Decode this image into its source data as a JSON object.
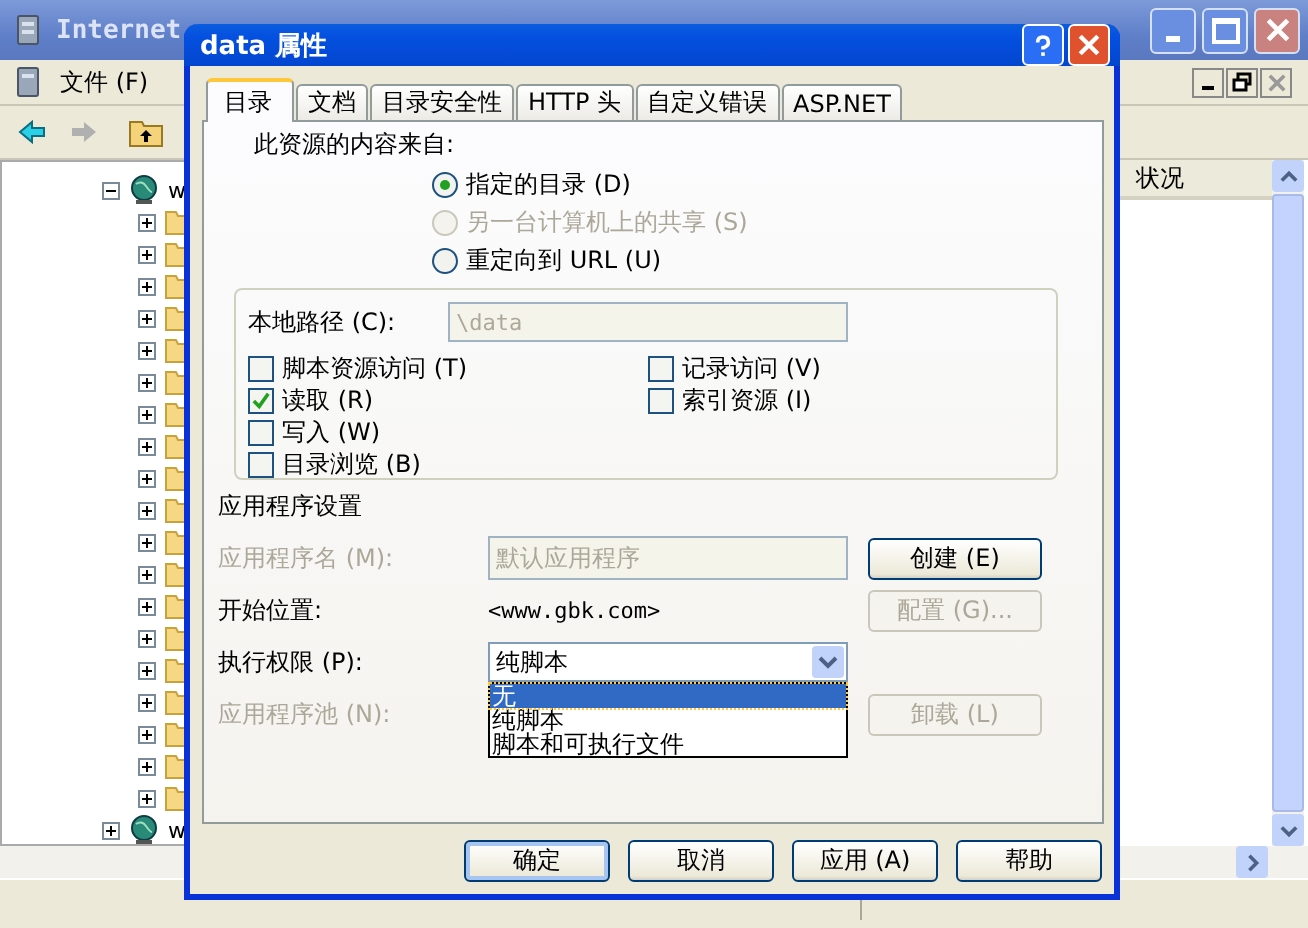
{
  "background_window": {
    "title": "Internet",
    "menu": [
      {
        "label": "文件 (F)"
      }
    ],
    "list_header": "状况",
    "tree": [
      {
        "label": "w",
        "expanded": true,
        "children": [
          {
            "expanded": false
          },
          {
            "expanded": false
          },
          {
            "expanded": false
          },
          {
            "expanded": false
          },
          {
            "expanded": false
          },
          {
            "expanded": false
          },
          {
            "expanded": false
          },
          {
            "expanded": false
          },
          {
            "expanded": false
          },
          {
            "expanded": false
          },
          {
            "expanded": false
          },
          {
            "expanded": false
          },
          {
            "expanded": false
          },
          {
            "expanded": false
          },
          {
            "expanded": false
          },
          {
            "expanded": false
          },
          {
            "expanded": false
          },
          {
            "expanded": false
          },
          {
            "expanded": false
          }
        ]
      },
      {
        "label": "w",
        "expanded": false
      }
    ]
  },
  "dialog": {
    "title": "data 属性",
    "tabs": [
      {
        "label": "目录",
        "selected": true
      },
      {
        "label": "文档",
        "selected": false
      },
      {
        "label": "目录安全性",
        "selected": false
      },
      {
        "label": "HTTP 头",
        "selected": false
      },
      {
        "label": "自定义错误",
        "selected": false
      },
      {
        "label": "ASP.NET",
        "selected": false
      }
    ],
    "content_source": {
      "label": "此资源的内容来自:",
      "options": [
        {
          "label": "指定的目录 (D)",
          "selected": true,
          "disabled": false
        },
        {
          "label": "另一台计算机上的共享 (S)",
          "selected": false,
          "disabled": true
        },
        {
          "label": "重定向到 URL (U)",
          "selected": false,
          "disabled": false
        }
      ]
    },
    "local_path": {
      "label": "本地路径 (C):",
      "value": "\\data",
      "disabled": true
    },
    "permissions": [
      {
        "label": "脚本资源访问 (T)",
        "checked": false
      },
      {
        "label": "读取 (R)",
        "checked": true
      },
      {
        "label": "写入 (W)",
        "checked": false
      },
      {
        "label": "目录浏览 (B)",
        "checked": false
      },
      {
        "label": "记录访问 (V)",
        "checked": false
      },
      {
        "label": "索引资源 (I)",
        "checked": false
      }
    ],
    "app_settings": {
      "title": "应用程序设置",
      "rows": [
        {
          "kind": "field",
          "label": "应用程序名 (M):",
          "disabled": true,
          "value": "默认应用程序",
          "button": {
            "label": "创建 (E)",
            "disabled": false
          }
        },
        {
          "kind": "text",
          "label": "开始位置:",
          "disabled": false,
          "value": "<www.gbk.com>",
          "button": {
            "label": "配置 (G)...",
            "disabled": true
          }
        },
        {
          "kind": "select",
          "label": "执行权限 (P):",
          "disabled": false,
          "value": "纯脚本",
          "expanded": true,
          "options": [
            {
              "label": "无",
              "highlighted": true
            },
            {
              "label": "纯脚本",
              "highlighted": false
            },
            {
              "label": "脚本和可执行文件",
              "highlighted": false
            }
          ]
        },
        {
          "kind": "hidden",
          "label": "应用程序池 (N):",
          "disabled": true,
          "button": {
            "label": "卸载 (L)",
            "disabled": true
          }
        }
      ]
    },
    "buttons": [
      {
        "label": "确定",
        "default": true
      },
      {
        "label": "取消",
        "default": false
      },
      {
        "label": "应用 (A)",
        "default": false
      },
      {
        "label": "帮助",
        "default": false
      }
    ]
  }
}
